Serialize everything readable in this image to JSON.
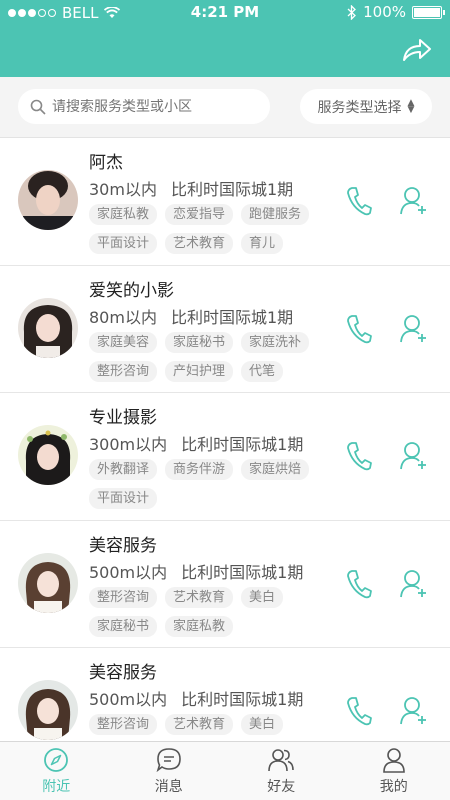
{
  "status_bar": {
    "carrier": "BELL",
    "time": "4:21 PM",
    "battery": "100%"
  },
  "header": {
    "share_icon": "share-icon"
  },
  "search": {
    "placeholder": "请搜索服务类型或小区",
    "filter_label": "服务类型选择"
  },
  "items": [
    {
      "name": "阿杰",
      "distance": "30m以内",
      "location": "比利时国际城1期",
      "tags": [
        "家庭私教",
        "恋爱指导",
        "跑健服务",
        "平面设计",
        "艺术教育",
        "育儿"
      ]
    },
    {
      "name": "爱笑的小影",
      "distance": "80m以内",
      "location": "比利时国际城1期",
      "tags": [
        "家庭美容",
        "家庭秘书",
        "家庭洗补",
        "整形咨询",
        "产妇护理",
        "代笔"
      ]
    },
    {
      "name": "专业摄影",
      "distance": "300m以内",
      "location": "比利时国际城1期",
      "tags": [
        "外教翻译",
        "商务伴游",
        "家庭烘焙",
        "平面设计"
      ]
    },
    {
      "name": "美容服务",
      "distance": "500m以内",
      "location": "比利时国际城1期",
      "tags": [
        "整形咨询",
        "艺术教育",
        "美白",
        "家庭秘书",
        "家庭私教"
      ]
    },
    {
      "name": "美容服务",
      "distance": "500m以内",
      "location": "比利时国际城1期",
      "tags": [
        "整形咨询",
        "艺术教育",
        "美白"
      ]
    }
  ],
  "tabs": [
    {
      "label": "附近",
      "active": true
    },
    {
      "label": "消息",
      "active": false
    },
    {
      "label": "好友",
      "active": false
    },
    {
      "label": "我的",
      "active": false
    }
  ],
  "colors": {
    "accent": "#4cc4b3"
  }
}
